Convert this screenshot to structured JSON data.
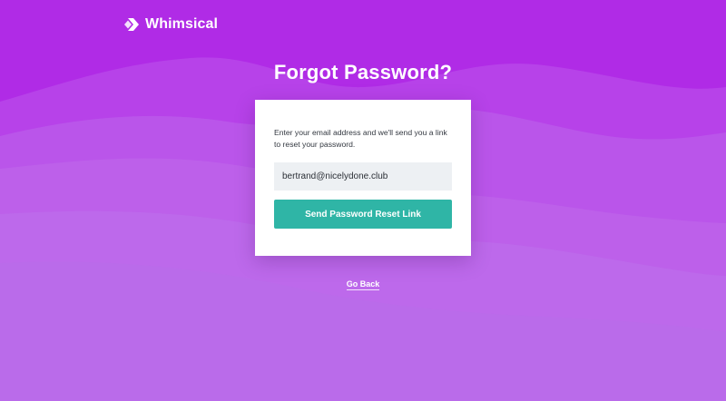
{
  "brand": {
    "name": "Whimsical",
    "logo_icon": "whimsical-logo-icon"
  },
  "title": "Forgot Password?",
  "form": {
    "instructions": "Enter your email address and we'll send you a link to reset your password.",
    "email_value": "bertrand@nicelydone.club",
    "submit_label": "Send Password Reset Link"
  },
  "go_back_label": "Go Back",
  "colors": {
    "background": "#b24be8",
    "button": "#2fb5a6",
    "card": "#ffffff",
    "input_bg": "#edf0f3"
  }
}
